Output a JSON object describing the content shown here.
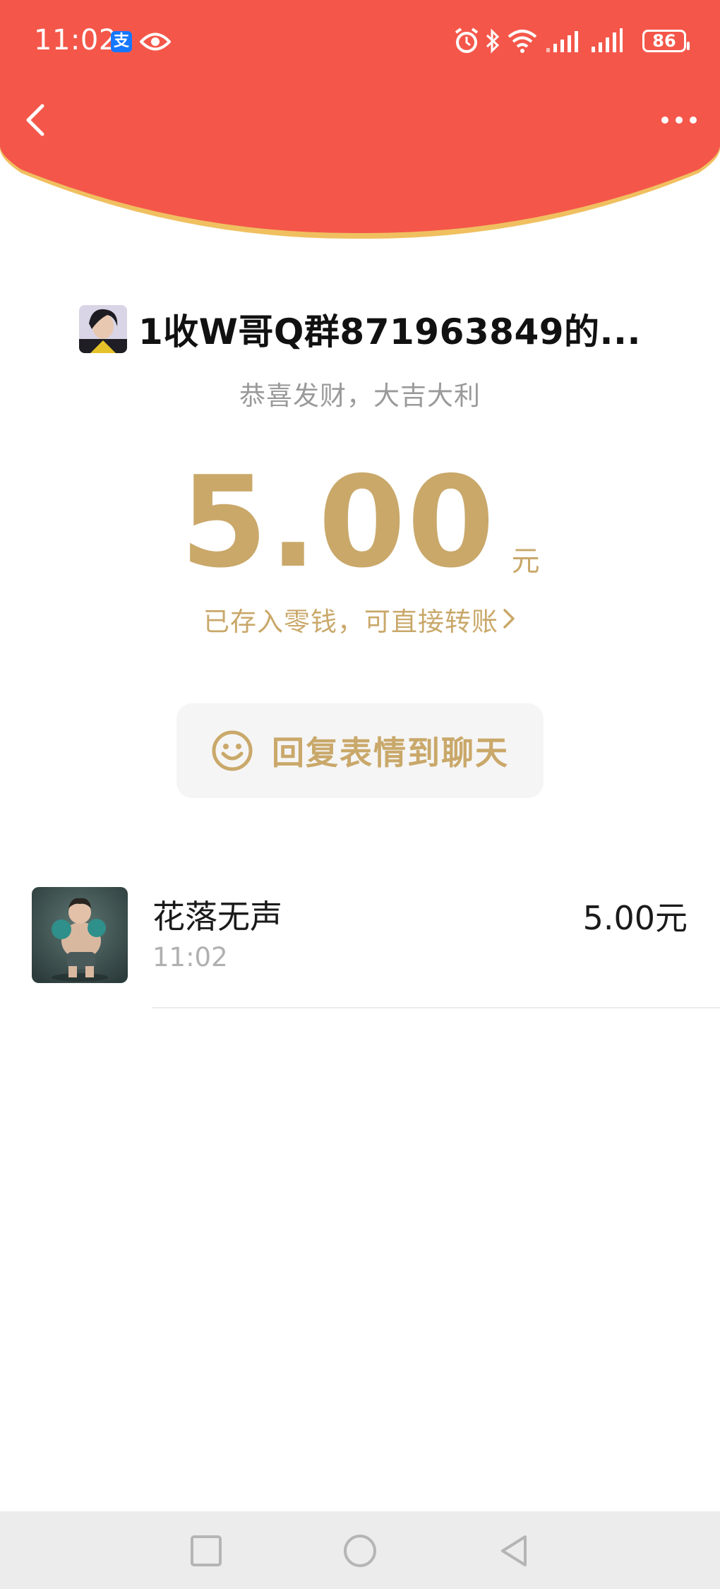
{
  "status_bar": {
    "time": "11:02",
    "alipay_glyph": "支",
    "battery": "86",
    "icons": [
      "alipay-icon",
      "eye-icon",
      "alarm-icon",
      "bluetooth-icon",
      "wifi-icon",
      "signal-icon",
      "signal-icon",
      "battery-icon"
    ]
  },
  "nav": {
    "back_icon": "chevron-left-icon",
    "more_icon": "more-dots-icon"
  },
  "sender": {
    "name": "1收W哥Q群871963849的...",
    "greeting": "恭喜发财，大吉大利"
  },
  "amount": {
    "value": "5.00",
    "unit": "元",
    "note": "已存入零钱，可直接转账",
    "note_icon": "chevron-right-icon"
  },
  "reply_button": {
    "label": "回复表情到聊天",
    "icon": "smiley-icon"
  },
  "receivers": [
    {
      "name": "花落无声",
      "time": "11:02",
      "amount": "5.00元"
    }
  ],
  "bottom_nav": {
    "icons": [
      "recents-square-icon",
      "home-circle-icon",
      "back-triangle-icon"
    ]
  },
  "colors": {
    "header_red": "#f4574a",
    "header_edge": "#f0c060",
    "gold": "#c9a86a",
    "reply_bg": "#f5f5f5"
  }
}
